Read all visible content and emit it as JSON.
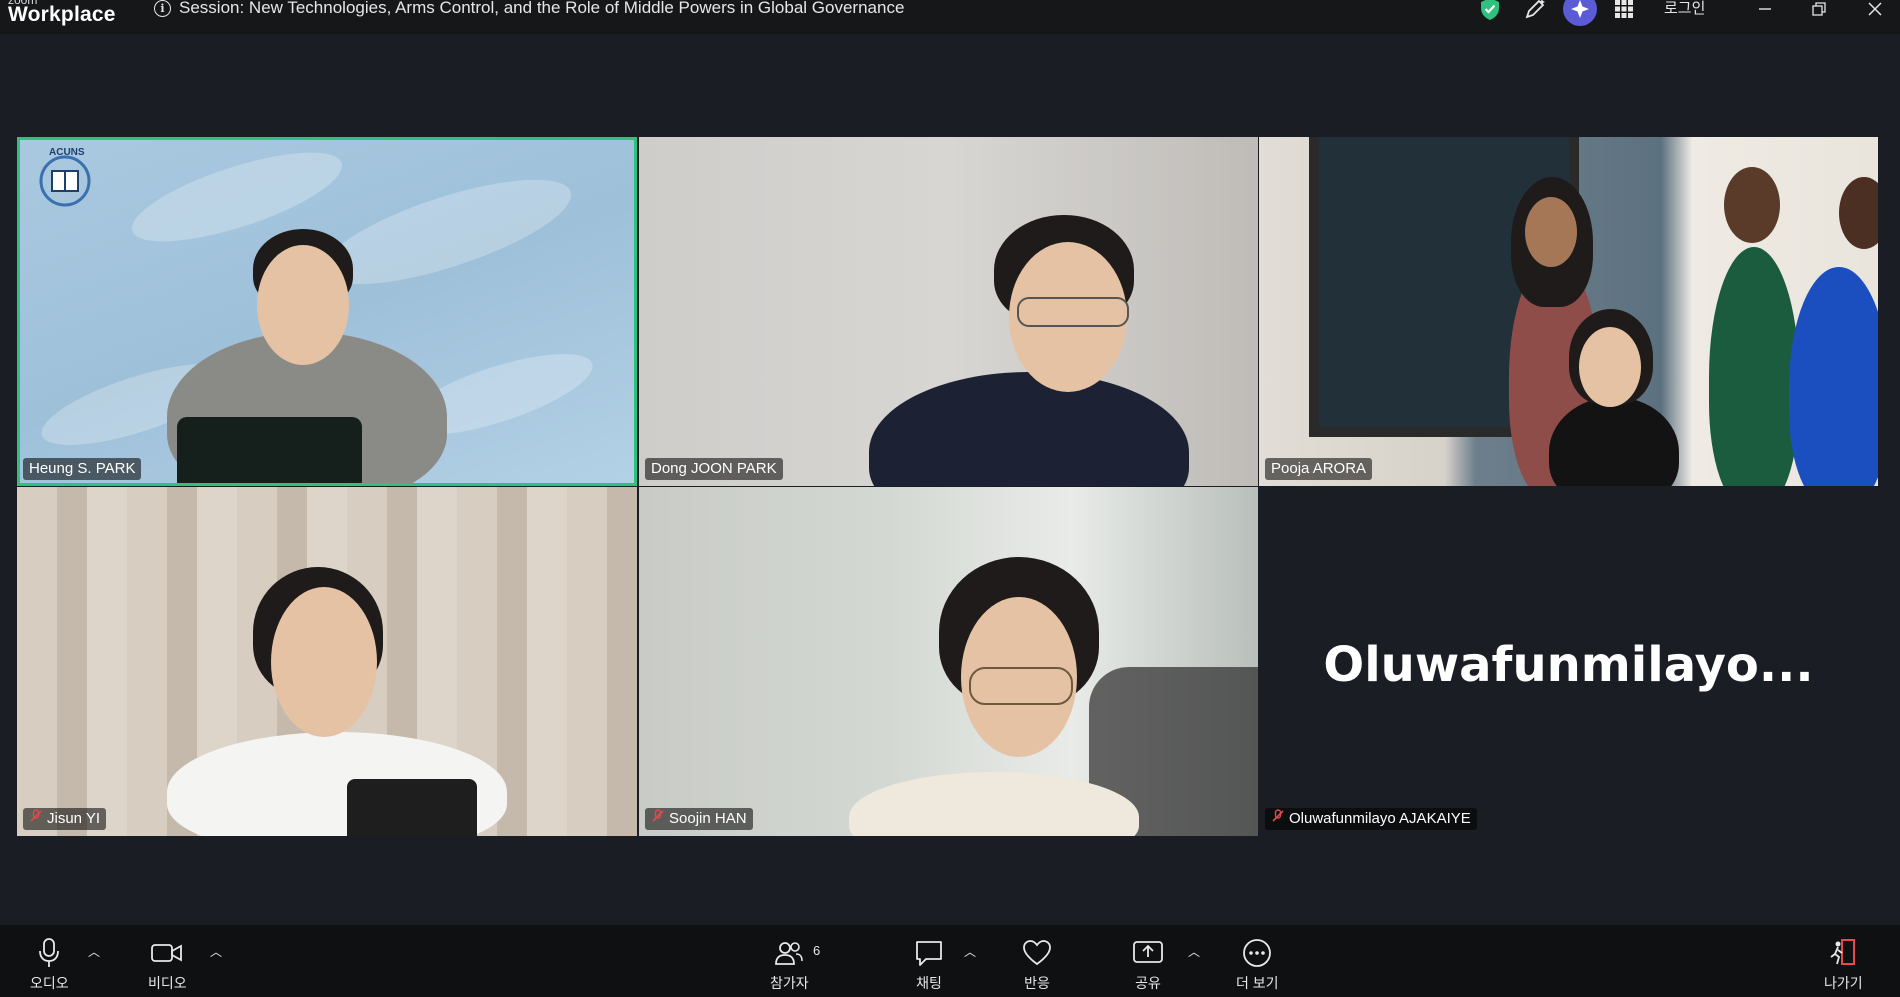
{
  "app": {
    "brand_small": "zoom",
    "brand_big": "Workplace"
  },
  "session": {
    "title": "Session: New Technologies, Arms Control, and the Role of Middle Powers in Global Governance"
  },
  "header": {
    "login_label": "로그인"
  },
  "participants": [
    {
      "name": "Heung S. PARK",
      "muted": false,
      "active_speaker": true,
      "logo_text": "ACUNS"
    },
    {
      "name": "Dong JOON PARK",
      "muted": false
    },
    {
      "name": "Pooja ARORA",
      "muted": false
    },
    {
      "name": "Jisun YI",
      "muted": true
    },
    {
      "name": "Soojin HAN",
      "muted": true
    },
    {
      "name": "Oluwafunmilayo AJAKAIYE",
      "muted": true,
      "video_off": true,
      "display_name": "Oluwafunmilayo..."
    }
  ],
  "toolbar": {
    "audio": "오디오",
    "video": "비디오",
    "participants": "참가자",
    "participants_count": "6",
    "chat": "채팅",
    "reactions": "반응",
    "share": "공유",
    "more": "더 보기",
    "leave": "나가기"
  },
  "colors": {
    "active_border": "#2ec27e",
    "mute": "#e5484d",
    "ai_button": "#5b5bd6",
    "leave_accent": "#e5484d"
  }
}
